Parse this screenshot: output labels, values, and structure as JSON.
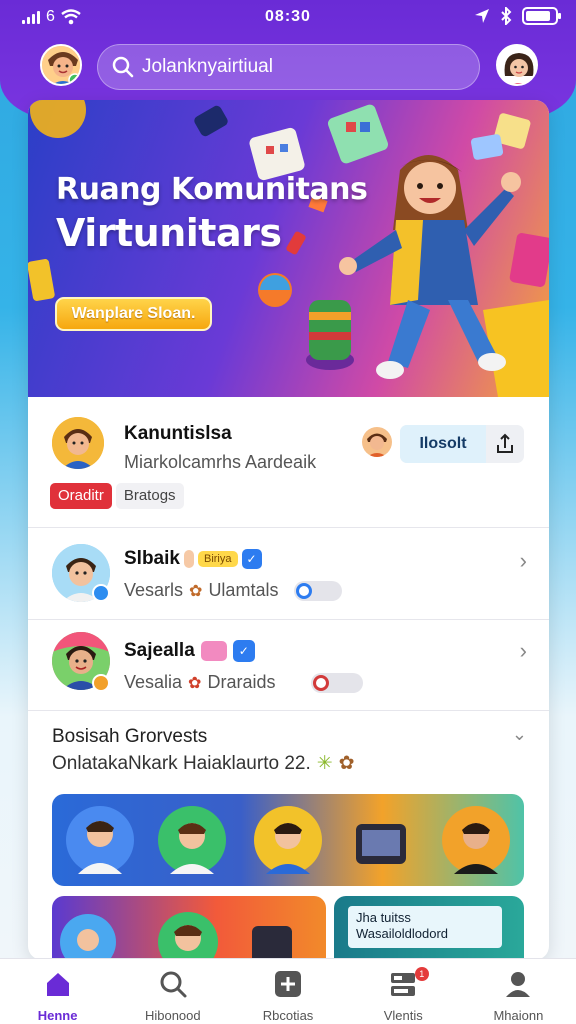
{
  "status_bar": {
    "network": "6",
    "time": "08:30"
  },
  "search": {
    "value": "Jolanknyairtiual",
    "icon": "search-icon"
  },
  "hero": {
    "title_line1": "Ruang Komunitans",
    "title_line2": "Virtunitars",
    "button_label": "Wanplare Sloan."
  },
  "community": {
    "name": "Kanuntislsa",
    "subtitle": "Miarkolcamrhs Aardeaik",
    "join_label": "Ilosolt",
    "tag_primary": "Oraditr",
    "tag_secondary": "Bratogs"
  },
  "members": [
    {
      "name": "Slbaik",
      "badge": "Biriya",
      "sub_left": "Vesarls",
      "sub_right": "Ulamtals"
    },
    {
      "name": "Sajealla",
      "sub_left": "Vesalia",
      "sub_right": "Draraids"
    }
  ],
  "section": {
    "title": "Bosisah Grorvests",
    "subtitle": "OnlatakaNkark Haiaklaurto 22."
  },
  "promo_tile": {
    "line1": "Jha tuitss",
    "line2": "Wasailoldlodord"
  },
  "bottom_nav": [
    {
      "label": "Henne",
      "icon": "home-icon",
      "active": true
    },
    {
      "label": "Hibonood",
      "icon": "search-icon",
      "active": false
    },
    {
      "label": "Rbcotias",
      "icon": "plus-icon",
      "active": false
    },
    {
      "label": "Vlentis",
      "icon": "events-icon",
      "active": false,
      "badge": "1"
    },
    {
      "label": "Mhaionn",
      "icon": "profile-icon",
      "active": false
    }
  ],
  "colors": {
    "brand_purple": "#6a2bd6",
    "accent_yellow": "#f6a70f",
    "tag_red": "#e0313a",
    "join_blue_bg": "#dff1fb"
  }
}
